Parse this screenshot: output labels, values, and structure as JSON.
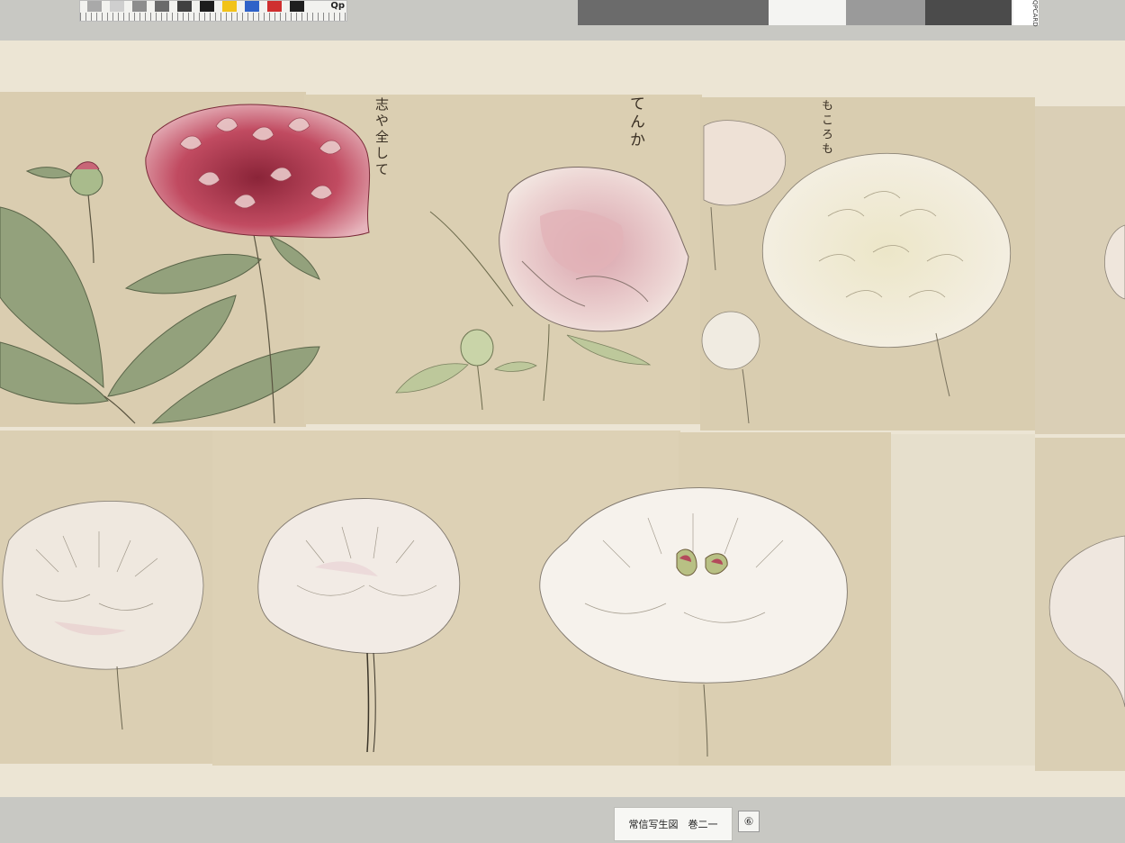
{
  "calibration": {
    "left_bar_brand": "Qp",
    "right_bar_brand": "QPCARD",
    "swatch_colors": [
      "#a9a9a9",
      "#cfcfcf",
      "#8d8d8d",
      "#6a6a6a",
      "#404040",
      "#1d1d1d",
      "#f2c318",
      "#2f62c8",
      "#cf2f2f",
      "#1e1e1e"
    ],
    "right_bar_colors": [
      "#6b6b6b",
      "#f4f4f2",
      "#9a9a9a",
      "#4b4b4b"
    ]
  },
  "inscriptions": [
    {
      "text": "志や全して"
    },
    {
      "text": "てんか"
    },
    {
      "text": "もころも"
    }
  ],
  "caption": {
    "title": "常信写生図　巻二一",
    "page_number": "⑥"
  },
  "colors": {
    "paper": "#dccfb3",
    "mount": "#ece5d4",
    "background": "#c8c8c3",
    "leaf": "#8fa078",
    "crimson": "#b94b5c",
    "blush": "#e8c2c6",
    "white_petal": "#f6f2ea"
  }
}
